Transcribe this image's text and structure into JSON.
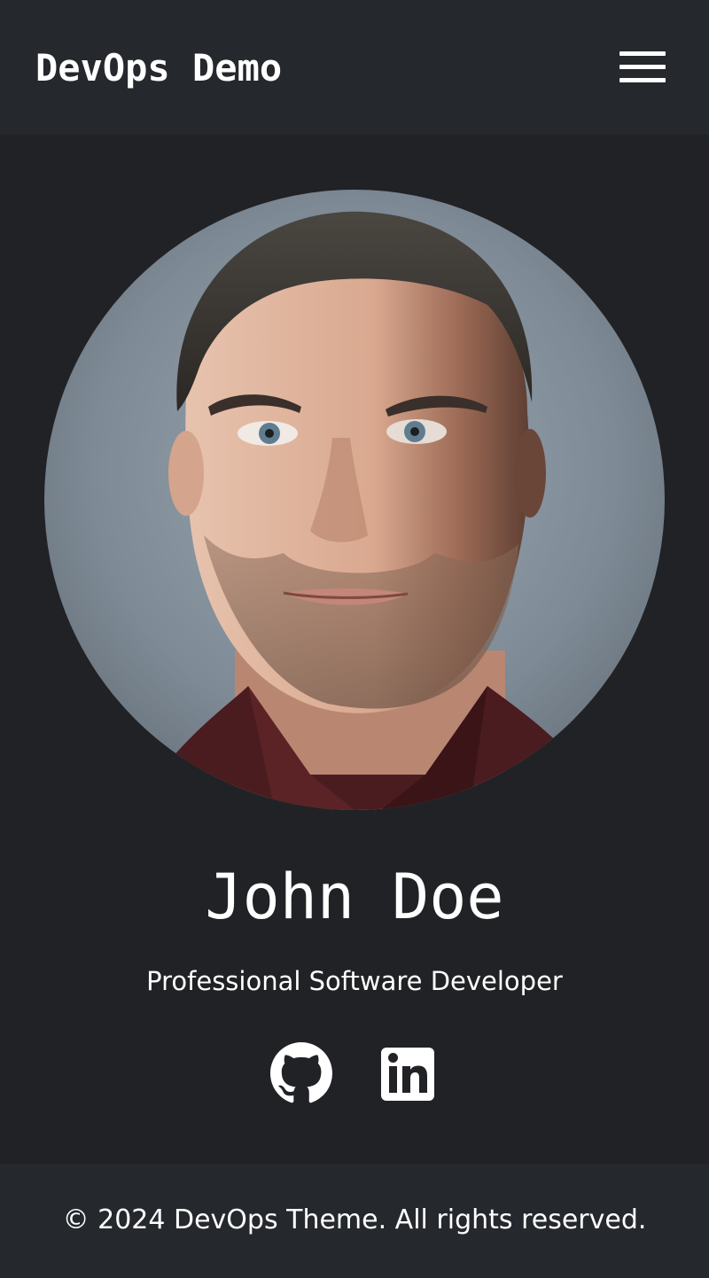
{
  "navbar": {
    "brand": "DevOps Demo",
    "menu_icon": "hamburger-menu-icon"
  },
  "profile": {
    "avatar_alt": "profile-photo",
    "name": "John Doe",
    "title": "Professional Software Developer"
  },
  "social": [
    {
      "icon": "github-icon"
    },
    {
      "icon": "linkedin-icon"
    }
  ],
  "footer": {
    "text": "© 2024 DevOps Theme. All rights reserved."
  },
  "colors": {
    "background": "#212226",
    "bar": "#25282c",
    "text": "#ffffff"
  }
}
